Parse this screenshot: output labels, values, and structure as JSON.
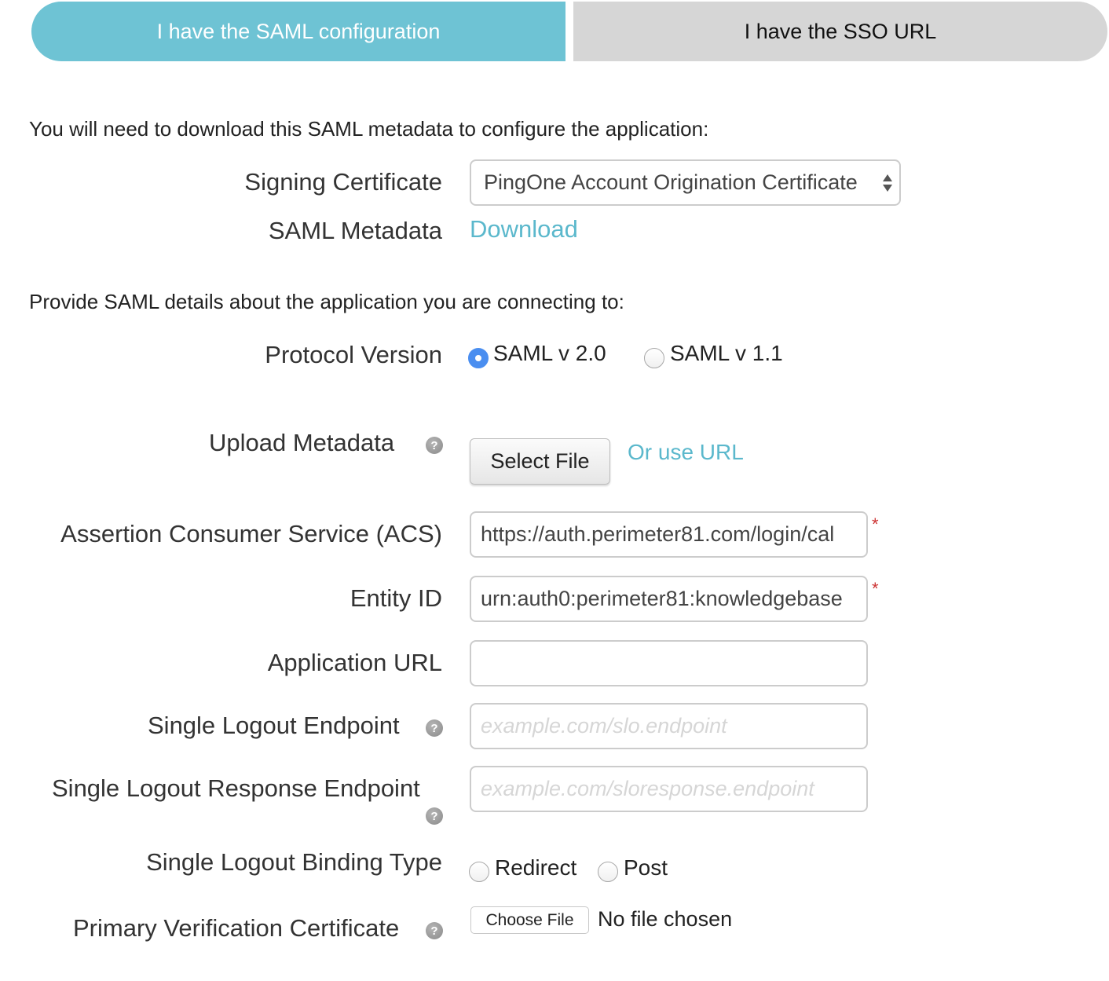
{
  "tabs": [
    {
      "label": "I have the SAML configuration",
      "active": true
    },
    {
      "label": "I have the SSO URL",
      "active": false
    }
  ],
  "colors": {
    "accent": "#6ec3d4",
    "link": "#5bb8cc",
    "radio_checked": "#4a8ef0",
    "required": "#cc3333"
  },
  "download_section": {
    "intro": "You will need to download this SAML metadata to configure the application:",
    "signing_certificate_label": "Signing Certificate",
    "signing_certificate_value": "PingOne Account Origination Certificate",
    "saml_metadata_label": "SAML Metadata",
    "download_link": "Download"
  },
  "details_section": {
    "intro": "Provide SAML details about the application you are connecting to:",
    "protocol_version_label": "Protocol Version",
    "protocol_options": [
      {
        "label": "SAML v 2.0",
        "checked": true
      },
      {
        "label": "SAML v 1.1",
        "checked": false
      }
    ],
    "upload_metadata_label": "Upload Metadata",
    "select_file_button": "Select File",
    "or_use_url_link": "Or use URL",
    "acs_label": "Assertion Consumer Service (ACS)",
    "acs_value": "https://auth.perimeter81.com/login/cal",
    "entity_id_label": "Entity ID",
    "entity_id_value": "urn:auth0:perimeter81:knowledgebase",
    "application_url_label": "Application URL",
    "application_url_value": "",
    "slo_endpoint_label": "Single Logout Endpoint",
    "slo_endpoint_placeholder": "example.com/slo.endpoint",
    "slo_response_label": "Single Logout Response Endpoint",
    "slo_response_placeholder": "example.com/sloresponse.endpoint",
    "slo_binding_label": "Single Logout Binding Type",
    "binding_options": [
      {
        "label": "Redirect",
        "checked": false
      },
      {
        "label": "Post",
        "checked": false
      }
    ],
    "primary_cert_label": "Primary Verification Certificate",
    "choose_file_button": "Choose File",
    "no_file_text": "No file chosen",
    "required_mark": "*",
    "help_glyph": "?"
  }
}
